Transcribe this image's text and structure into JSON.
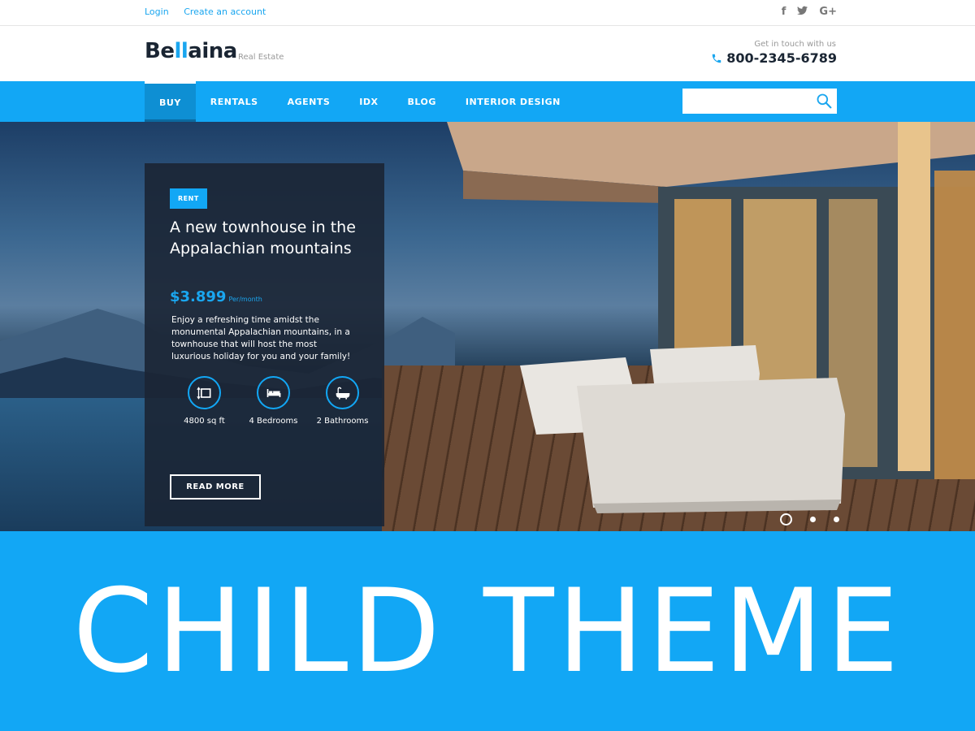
{
  "topbar": {
    "login": "Login",
    "create_account": "Create an account",
    "social": [
      {
        "icon": "facebook-icon",
        "glyph": "f"
      },
      {
        "icon": "twitter-icon",
        "glyph": "t"
      },
      {
        "icon": "google-plus-icon",
        "glyph": "G+"
      }
    ]
  },
  "header": {
    "logo_part1": "Be",
    "logo_part2": "ll",
    "logo_part3": "aina",
    "tagline": "Real Estate",
    "contact_label": "Get in touch with us",
    "phone": "800-2345-6789"
  },
  "nav": {
    "items": [
      "BUY",
      "RENTALS",
      "AGENTS",
      "IDX",
      "BLOG",
      "INTERIOR DESIGN"
    ],
    "active_index": 0,
    "search_placeholder": ""
  },
  "hero": {
    "badge": "RENT",
    "title": "A new townhouse in the Appalachian mountains",
    "price": "$3.899",
    "price_unit": "Per/month",
    "description": "Enjoy a refreshing time amidst the monumental Appalachian mountains, in a townhouse that will host the most luxurious holiday for you and your family!",
    "features": [
      {
        "icon": "area-icon",
        "label": "4800 sq ft"
      },
      {
        "icon": "bed-icon",
        "label": "4 Bedrooms"
      },
      {
        "icon": "bathtub-icon",
        "label": "2 Bathrooms"
      }
    ],
    "read_more": "READ MORE",
    "slides_total": 3,
    "slide_active": 1
  },
  "banner": {
    "text": "CHILD THEME"
  },
  "colors": {
    "accent": "#12a7f5",
    "dark": "#1a2533"
  }
}
